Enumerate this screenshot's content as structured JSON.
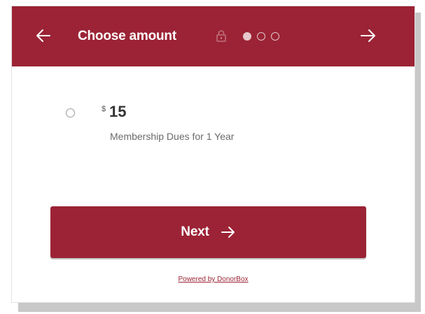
{
  "colors": {
    "accent": "#9b2335",
    "shadow": "#c8c8c8"
  },
  "header": {
    "back_icon": "arrow-left-icon",
    "title": "Choose amount",
    "lock_icon": "lock-icon",
    "steps": {
      "total": 3,
      "current": 1
    },
    "forward_icon": "arrow-right-icon"
  },
  "option": {
    "currency": "$",
    "amount": "15",
    "description": "Membership Dues for 1 Year",
    "selected": false
  },
  "next_button": {
    "label": "Next",
    "icon": "arrow-right-icon"
  },
  "footer": {
    "powered_by": "Powered by DonorBox"
  }
}
